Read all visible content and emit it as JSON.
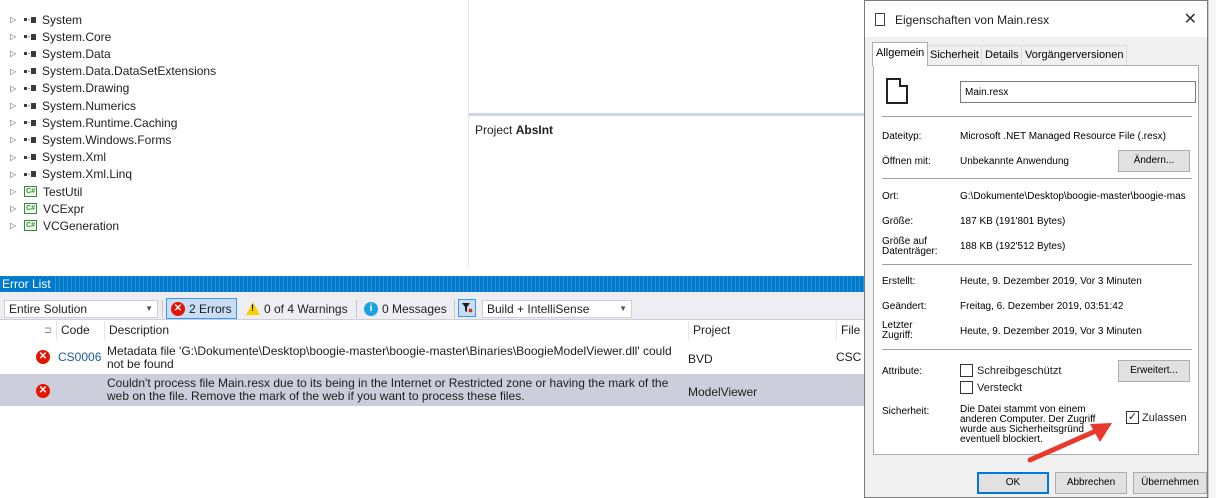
{
  "tree": {
    "items": [
      {
        "label": "System",
        "kind": "ref"
      },
      {
        "label": "System.Core",
        "kind": "ref"
      },
      {
        "label": "System.Data",
        "kind": "ref"
      },
      {
        "label": "System.Data.DataSetExtensions",
        "kind": "ref"
      },
      {
        "label": "System.Drawing",
        "kind": "ref"
      },
      {
        "label": "System.Numerics",
        "kind": "ref"
      },
      {
        "label": "System.Runtime.Caching",
        "kind": "ref"
      },
      {
        "label": "System.Windows.Forms",
        "kind": "ref"
      },
      {
        "label": "System.Xml",
        "kind": "ref"
      },
      {
        "label": "System.Xml.Linq",
        "kind": "ref"
      },
      {
        "label": "TestUtil",
        "kind": "project"
      },
      {
        "label": "VCExpr",
        "kind": "project"
      },
      {
        "label": "VCGeneration",
        "kind": "project"
      }
    ]
  },
  "middle": {
    "project_prefix": "Project",
    "project_name": "AbsInt"
  },
  "error_list": {
    "title": "Error List",
    "scope": "Entire Solution",
    "errors_label": "2 Errors",
    "warnings_label": "0 of 4 Warnings",
    "messages_label": "0 Messages",
    "build_filter": "Build + IntelliSense",
    "columns": {
      "code": "Code",
      "description": "Description",
      "project": "Project",
      "file": "File"
    },
    "rows": [
      {
        "code": "CS0006",
        "description": "Metadata file 'G:\\Dokumente\\Desktop\\boogie-master\\boogie-master\\Binaries\\BoogieModelViewer.dll' could not be found",
        "project": "BVD",
        "file": "CSC"
      },
      {
        "code": "",
        "description": "Couldn't process file Main.resx due to its being in the Internet or Restricted zone or having the mark of the web on the file. Remove the mark of the web if you want to process these files.",
        "project": "ModelViewer",
        "file": ""
      }
    ]
  },
  "dialog": {
    "title": "Eigenschaften von Main.resx",
    "close_glyph": "✕",
    "tabs": [
      "Allgemein",
      "Sicherheit",
      "Details",
      "Vorgängerversionen"
    ],
    "filename": "Main.resx",
    "dateityp_label": "Dateityp:",
    "dateityp": "Microsoft .NET Managed Resource File (.resx)",
    "oeffnen_label": "Öffnen mit:",
    "oeffnen": "Unbekannte Anwendung",
    "aendern_btn": "Ändern...",
    "ort_label": "Ort:",
    "ort": "G:\\Dokumente\\Desktop\\boogie-master\\boogie-mas",
    "groesse_label": "Größe:",
    "groesse": "187 KB (191'801 Bytes)",
    "groesse_dt_label_1": "Größe auf",
    "groesse_dt_label_2": "Datenträger:",
    "groesse_dt": "188 KB (192'512 Bytes)",
    "erstellt_label": "Erstellt:",
    "erstellt": "Heute, 9. Dezember 2019, Vor 3 Minuten",
    "geaendert_label": "Geändert:",
    "geaendert": "Freitag, 6. Dezember 2019, 03:51:42",
    "zugriff_label_1": "Letzter",
    "zugriff_label_2": "Zugriff:",
    "zugriff": "Heute, 9. Dezember 2019, Vor 3 Minuten",
    "attribute_label": "Attribute:",
    "schreibgeschuetzt": "Schreibgeschützt",
    "versteckt": "Versteckt",
    "erweitert_btn": "Erweitert...",
    "sicherheit_label": "Sicherheit:",
    "sicherheit_text_1": "Die Datei stammt von einem",
    "sicherheit_text_2": "anderen Computer. Der Zugriff",
    "sicherheit_text_3": "wurde aus Sicherheitsgründ",
    "sicherheit_text_4": "eventuell blockiert.",
    "zulassen": "Zulassen",
    "zulassen_checked": true,
    "ok_btn": "OK",
    "abbrechen_btn": "Abbrechen",
    "uebernehmen_btn": "Übernehmen"
  },
  "colors": {
    "accent": "#007acc",
    "error": "#e51400",
    "arrow": "#e8392c"
  }
}
